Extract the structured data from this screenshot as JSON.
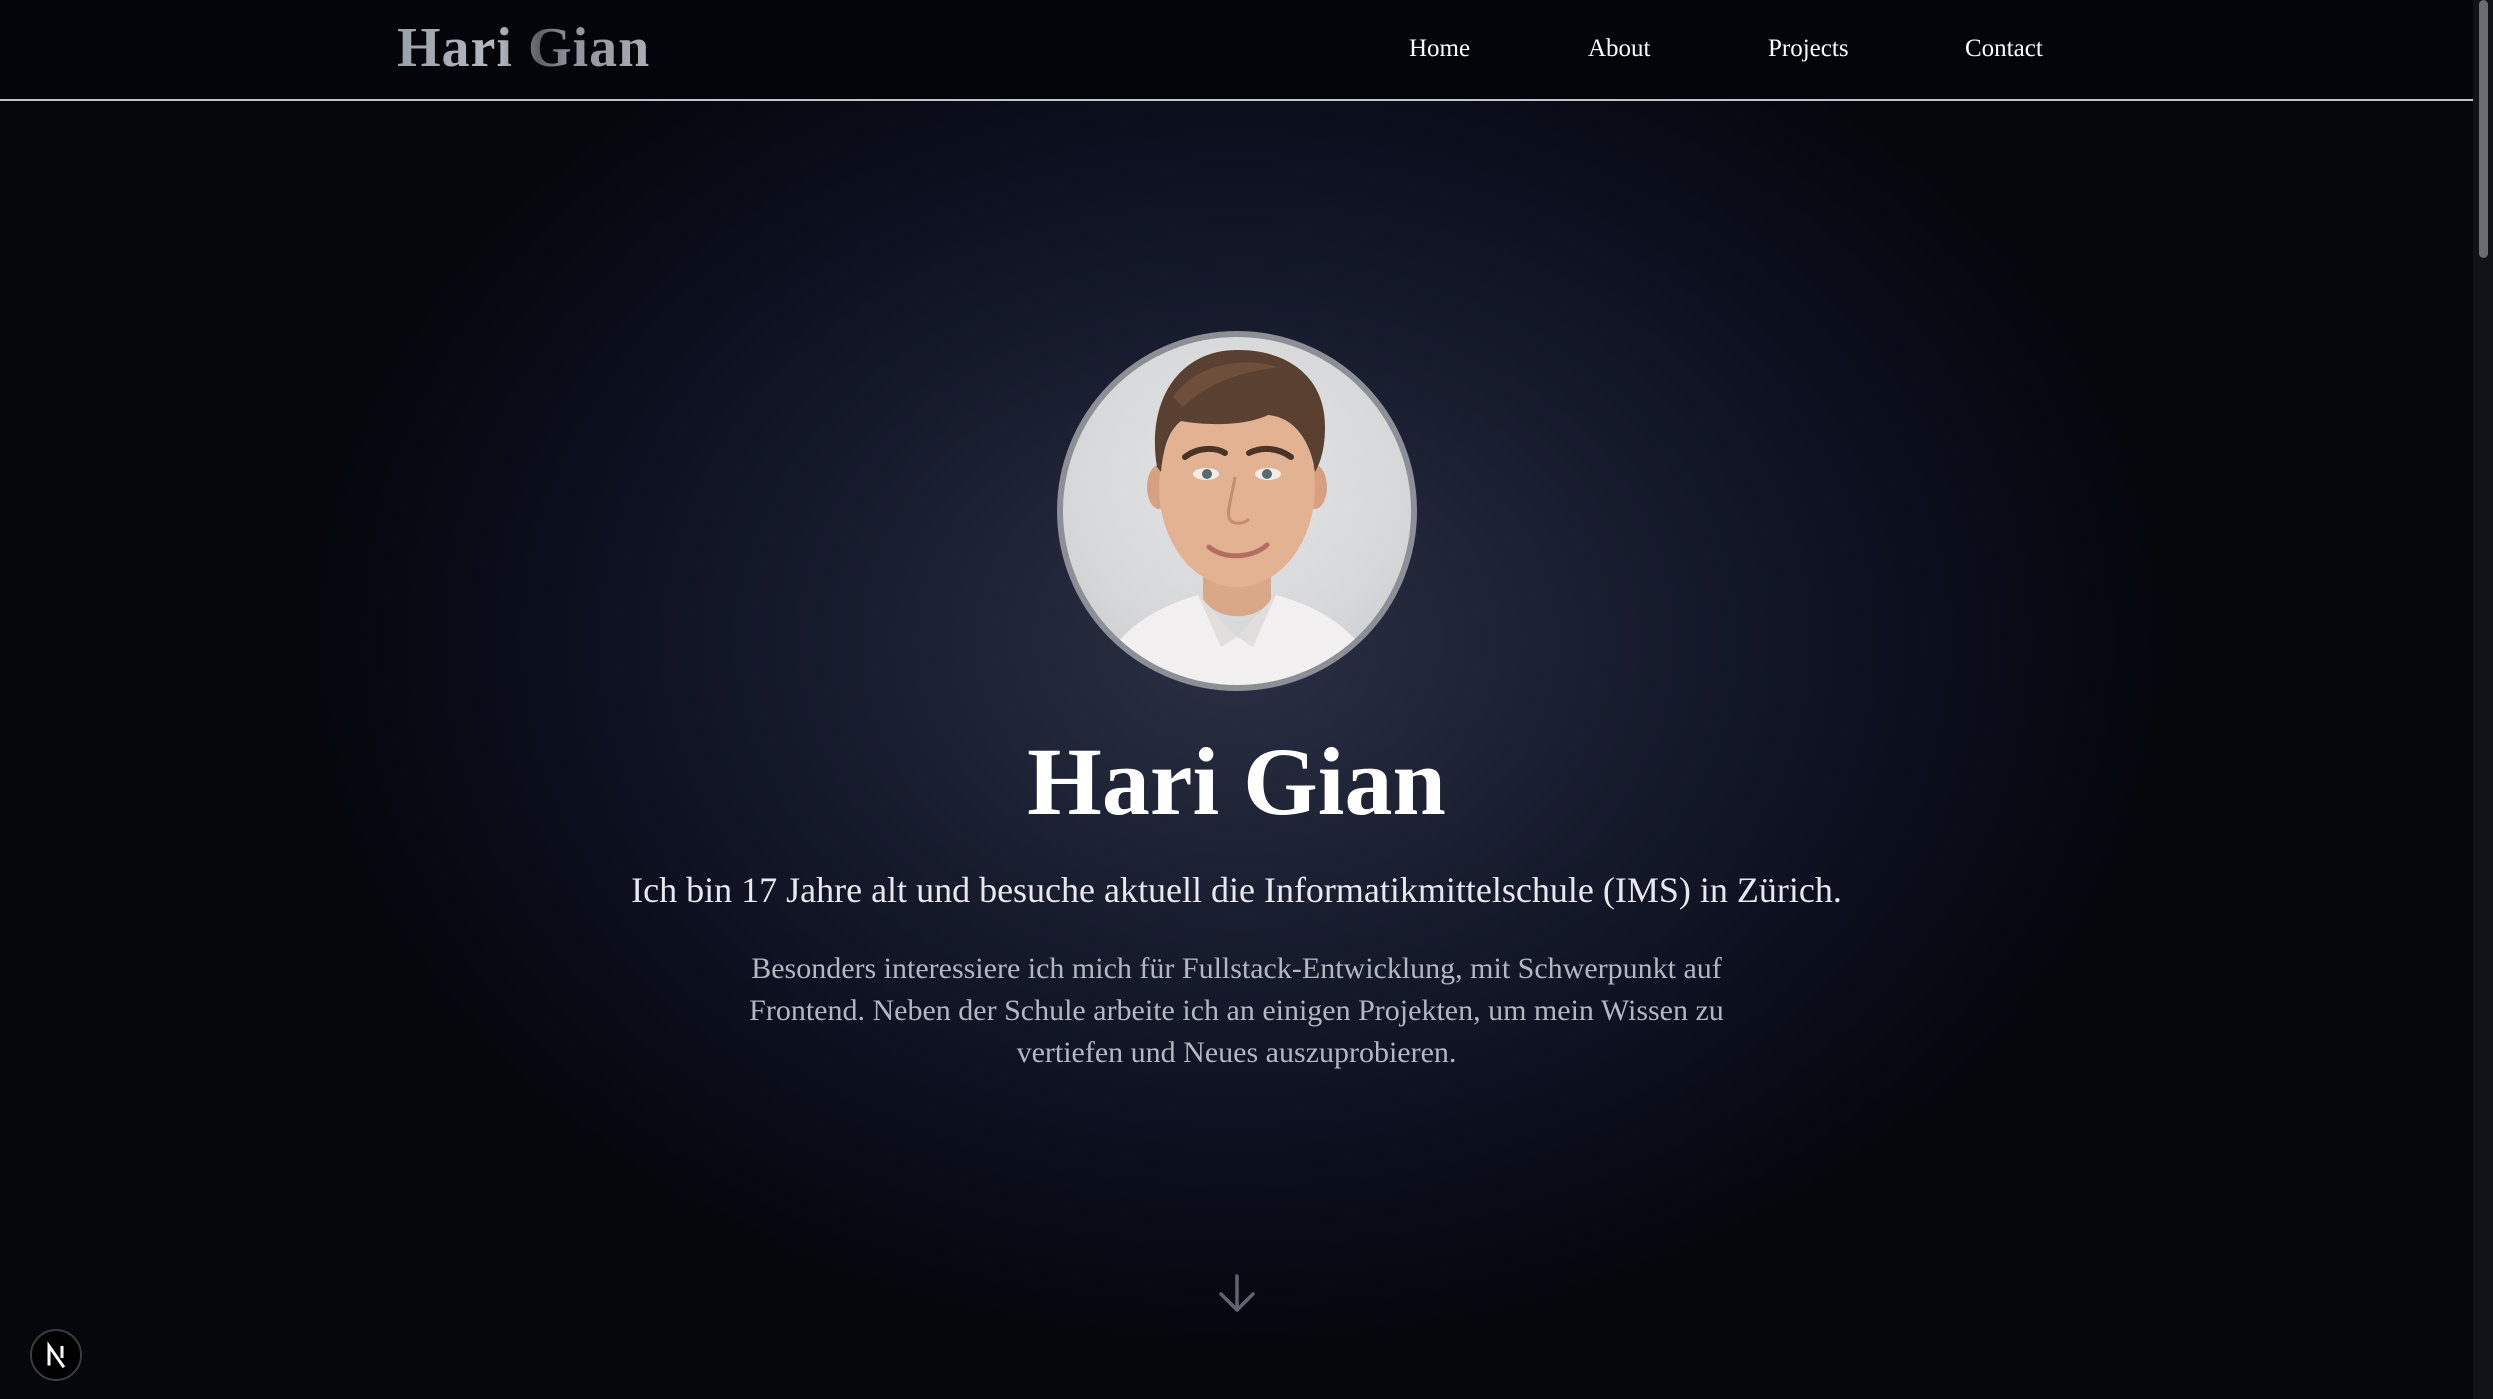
{
  "header": {
    "logo": "Hari Gian",
    "nav": [
      {
        "label": "Home"
      },
      {
        "label": "About"
      },
      {
        "label": "Projects"
      },
      {
        "label": "Contact"
      }
    ]
  },
  "hero": {
    "avatar_alt": "Hari Gian",
    "name": "Hari Gian",
    "subtitle": "Ich bin 17 Jahre alt und besuche aktuell die Informatikmittelschule (IMS) in Zürich.",
    "description": "Besonders interessiere ich mich für Fullstack-Entwicklung, mit Schwerpunkt auf Frontend. Neben der Schule arbeite ich an einigen Projekten, um mein Wissen zu vertiefen und Neues auszuprobieren."
  },
  "icons": {
    "scroll_down": "arrow-down-icon",
    "dev_badge": "nextjs-icon"
  },
  "colors": {
    "background": "#05070d",
    "header_bg": "#03050a",
    "accent_text": "#ffffff",
    "muted_text": "#b3b7c2"
  }
}
